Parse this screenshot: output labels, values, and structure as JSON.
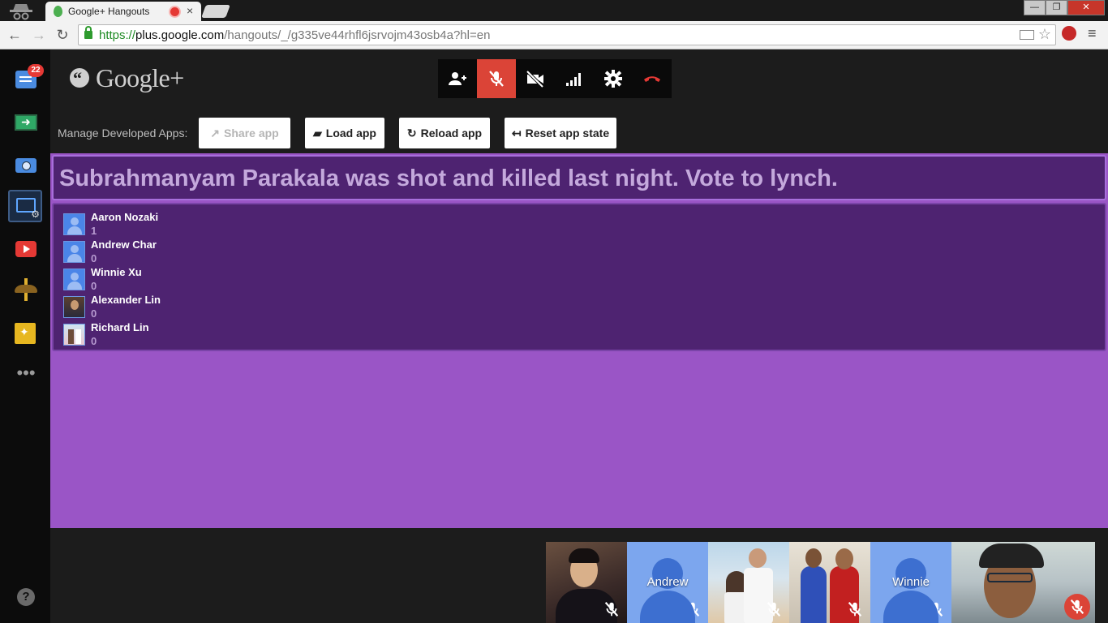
{
  "browser": {
    "tab_title": "Google+ Hangouts",
    "tab_close": "×",
    "url_scheme": "https://",
    "url_host": "plus.google.com",
    "url_path": "/hangouts/_/g335ve44rhfl6jsrvojm43osb4a?hl=en",
    "window_minimize": "—",
    "window_maximize": "❐",
    "window_close": "✕"
  },
  "rail": {
    "notifications_count": "22",
    "help_label": "?",
    "more_label": "•••",
    "icons": [
      "chat-icon",
      "screenshare-icon",
      "camera-icon",
      "developer-app-icon",
      "youtube-icon",
      "mustache-effects-icon",
      "google-effects-icon",
      "more-icon",
      "help-icon"
    ]
  },
  "header": {
    "logo_text": "Google+"
  },
  "callbar": {
    "buttons": [
      "invite-people-icon",
      "microphone-muted-icon",
      "camera-off-icon",
      "bandwidth-icon",
      "settings-icon",
      "hang-up-icon"
    ],
    "accent": "#db4437"
  },
  "dev_apps": {
    "label": "Manage Developed Apps:",
    "share": "Share app",
    "load": "Load app",
    "reload": "Reload app",
    "reset": "Reset app state"
  },
  "app": {
    "headline": "Subrahmanyam Parakala was shot and killed last night. Vote to lynch.",
    "background": "#9a55c6",
    "panel_color": "#4e2371",
    "players": [
      {
        "name": "Aaron Nozaki",
        "votes": "1",
        "avatar": "default"
      },
      {
        "name": "Andrew Char",
        "votes": "0",
        "avatar": "default"
      },
      {
        "name": "Winnie Xu",
        "votes": "0",
        "avatar": "default"
      },
      {
        "name": "Alexander Lin",
        "votes": "0",
        "avatar": "photo"
      },
      {
        "name": "Richard Lin",
        "votes": "0",
        "avatar": "photo"
      }
    ]
  },
  "filmstrip": {
    "tiles": [
      {
        "label": "",
        "type": "photo"
      },
      {
        "label": "Andrew",
        "type": "generic"
      },
      {
        "label": "",
        "type": "photo"
      },
      {
        "label": "",
        "type": "photo"
      },
      {
        "label": "Winnie",
        "type": "generic"
      },
      {
        "label": "",
        "type": "self"
      }
    ]
  }
}
